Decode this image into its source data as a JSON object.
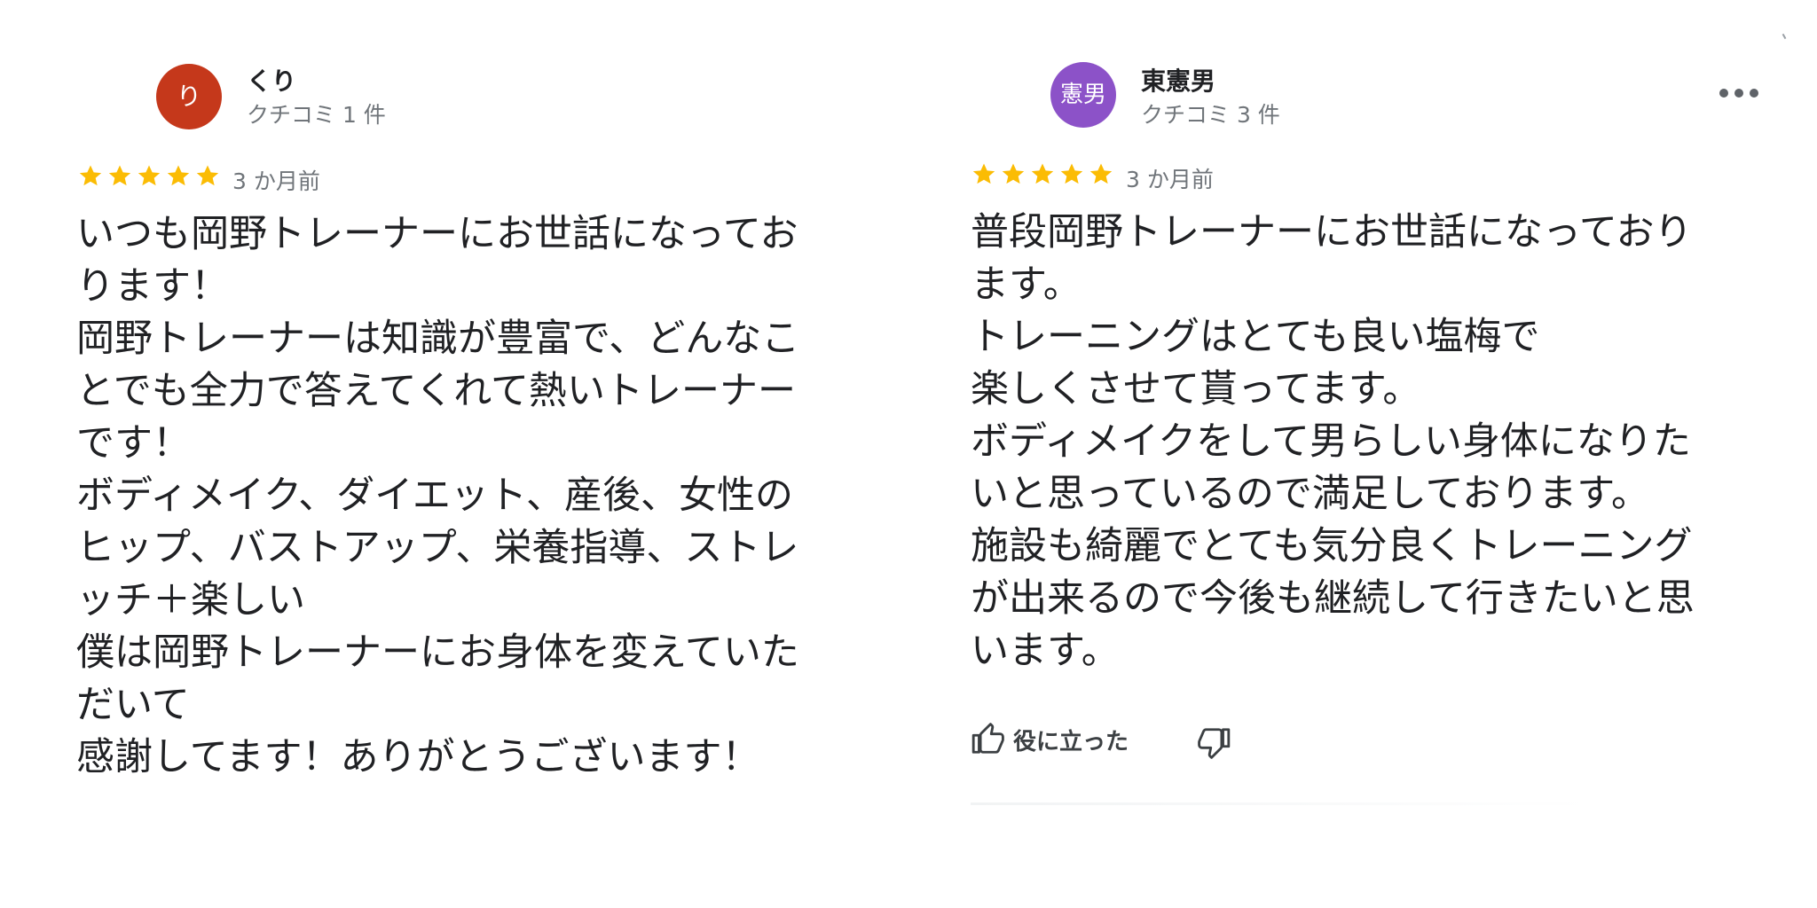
{
  "reviews": [
    {
      "avatar_initial": "り",
      "avatar_color": "#c5381b",
      "author": "くり",
      "review_count": "クチコミ 1 件",
      "rating": 5,
      "date": "3 か月前",
      "body_lines": [
        "いつも岡野トレーナーにお世話になってお",
        "ります！",
        "岡野トレーナーは知識が豊富で、どんなこ",
        "とでも全力で答えてくれて熱いトレーナー",
        "です！",
        "ボディメイク、ダイエット、産後、女性の",
        "ヒップ、バストアップ、栄養指導、ストレ",
        "ッチ＋楽しい",
        "僕は岡野トレーナーにお身体を変えていた",
        "だいて",
        "感謝してます！ありがとうございます！"
      ]
    },
    {
      "avatar_initial": "憲男",
      "avatar_color": "#8c52c8",
      "author": "東憲男",
      "review_count": "クチコミ 3 件",
      "rating": 5,
      "date": "3 か月前",
      "body_lines": [
        "普段岡野トレーナーにお世話になっており",
        "ます。",
        "トレーニングはとても良い塩梅で",
        "楽しくさせて貰ってます。",
        "ボディメイクをして男らしい身体になりた",
        "いと思っているので満足しております。",
        "施設も綺麗でとても気分良くトレーニング",
        "が出来るので今後も継続して行きたいと思",
        "います。"
      ],
      "helpful_label": "役に立った"
    }
  ],
  "colors": {
    "star": "#fbbc04",
    "secondary_text": "#70757a",
    "primary_text": "#202124"
  },
  "icons": {
    "more": "more-horiz-icon",
    "like": "thumb-up-icon",
    "dislike": "thumb-down-icon",
    "star": "star-icon"
  }
}
